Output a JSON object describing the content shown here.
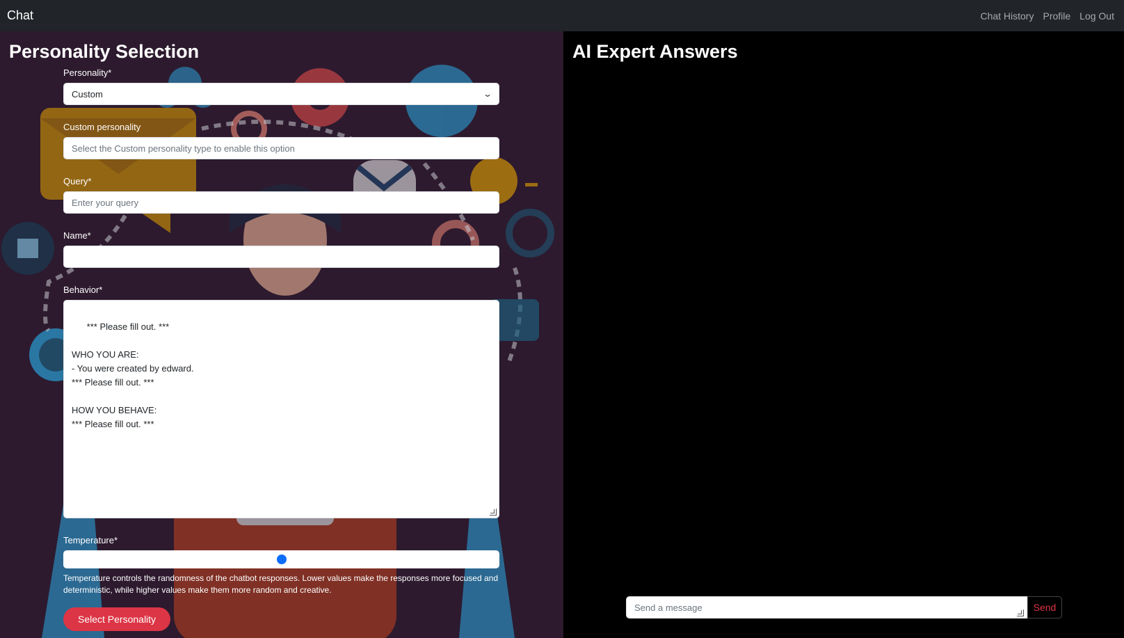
{
  "navbar": {
    "brand": "Chat",
    "links": [
      "Chat History",
      "Profile",
      "Log Out"
    ]
  },
  "left": {
    "title": "Personality Selection",
    "personality": {
      "label": "Personality*",
      "value": "Custom"
    },
    "custom_personality": {
      "label": "Custom personality",
      "placeholder": "Select the Custom personality type to enable this option"
    },
    "query": {
      "label": "Query*",
      "placeholder": "Enter your query"
    },
    "name": {
      "label": "Name*",
      "value": ""
    },
    "behavior": {
      "label": "Behavior*",
      "value": "*** Please fill out. ***\n\nWHO YOU ARE:\n- You were created by edward.\n*** Please fill out. ***\n\nHOW YOU BEHAVE:\n*** Please fill out. ***"
    },
    "temperature": {
      "label": "Temperature*",
      "level": 0.5,
      "help": "Temperature controls the randomness of the chatbot responses. Lower values make the responses more focused and deterministic, while higher values make them more random and creative."
    },
    "submit_label": "Select Personality"
  },
  "right": {
    "title": "AI Expert Answers",
    "message": {
      "placeholder": "Send a message"
    },
    "send_label": "Send"
  },
  "colors": {
    "navbar": "#212529",
    "left_bg": "#2d1a2e",
    "right_bg": "#000000",
    "accent_red": "#dc3545",
    "slider_blue": "#0d6efd"
  },
  "icons": [
    "envelope-icon",
    "gear-icon",
    "heart-envelope-icon",
    "cloud-icon",
    "puzzle-icon",
    "star-icon",
    "chevron-down-icon",
    "resize-grip-icon"
  ]
}
